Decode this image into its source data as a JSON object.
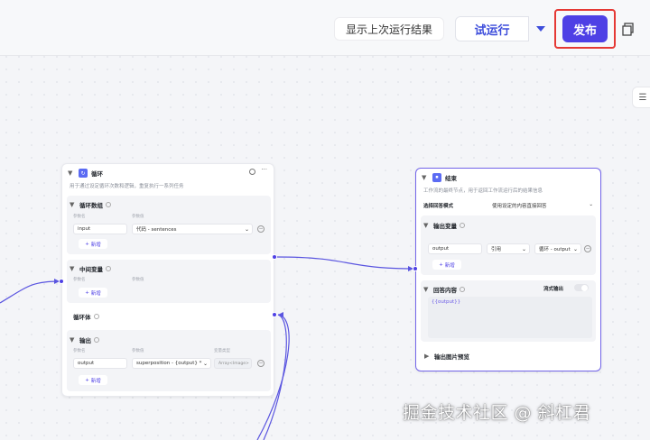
{
  "toolbar": {
    "history_label": "显示上次运行结果",
    "trial_label": "试运行",
    "publish_label": "发布"
  },
  "loop_node": {
    "title": "循环",
    "desc": "用于通过设定循环次数和逻辑，重复执行一系列任务",
    "array_section": "循环数组",
    "array_param_lbl": "参数名",
    "array_value_lbl": "参数值",
    "array_name": "input",
    "array_value": "代码 - sentences",
    "add_label": "新增",
    "mid_section": "中间变量",
    "mid_param_lbl": "参数名",
    "mid_value_lbl": "参数值",
    "body_label": "循环体",
    "output_section": "输出",
    "out_param_lbl": "参数名",
    "out_value_lbl": "参数值",
    "out_type_lbl": "变量类型",
    "out_name": "output",
    "out_value": "superposition - {output} *",
    "out_type": "Array<Image>"
  },
  "end_node": {
    "title": "结束",
    "desc": "工作流的最终节点，用于返回工作流运行后的结果信息",
    "mode_label": "选择回答模式",
    "mode_value": "使用设定的内容直接回答",
    "output_section": "输出变量",
    "out_name": "output",
    "ref_label": "引用",
    "ref_value": "循环 - output",
    "add_label": "新增",
    "answer_section": "回答内容",
    "stream_label": "流式输出",
    "answer_text": "{{output}}",
    "preview_label": "输出图片预览"
  },
  "watermark": "掘金技术社区 @ 斜杠君"
}
